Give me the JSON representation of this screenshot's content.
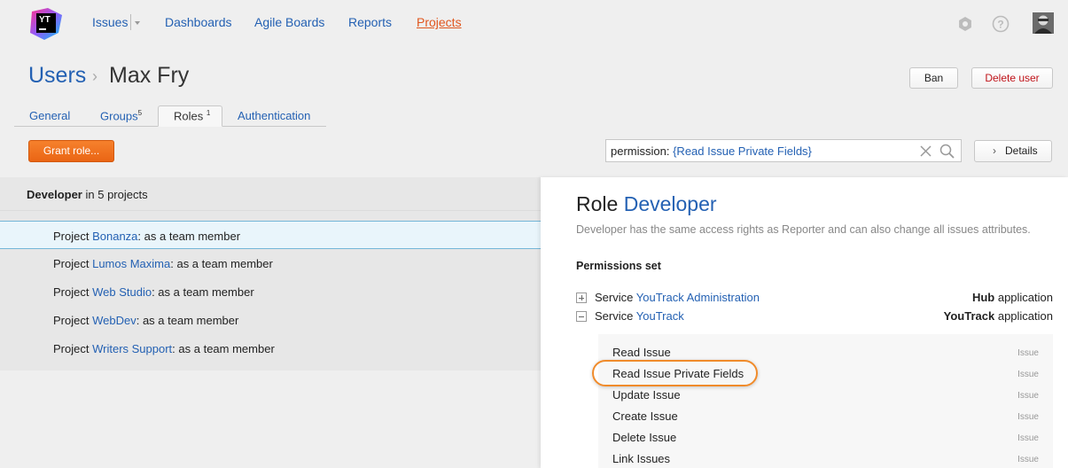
{
  "nav": {
    "logo_text": "YT",
    "items": [
      "Issues",
      "Dashboards",
      "Agile Boards",
      "Reports",
      "Projects"
    ],
    "active": "Projects"
  },
  "breadcrumb": {
    "parent": "Users",
    "separator": "›",
    "current": "Max Fry"
  },
  "actions": {
    "ban": "Ban",
    "delete": "Delete user"
  },
  "tabs": [
    {
      "label": "General",
      "count": ""
    },
    {
      "label": "Groups",
      "count": "5"
    },
    {
      "label": "Roles",
      "count": "1"
    },
    {
      "label": "Authentication",
      "count": ""
    }
  ],
  "grant_button": "Grant role...",
  "search": {
    "prefix": "permission:",
    "value": "{Read Issue Private Fields}"
  },
  "details_button": "Details",
  "left": {
    "header_role": "Developer",
    "header_suffix": "in 5 projects",
    "projects": [
      {
        "prefix": "Project",
        "name": "Bonanza",
        "suffix": ": as a team member"
      },
      {
        "prefix": "Project",
        "name": "Lumos Maxima",
        "suffix": ": as a team member"
      },
      {
        "prefix": "Project",
        "name": "Web Studio",
        "suffix": ": as a team member"
      },
      {
        "prefix": "Project",
        "name": "WebDev",
        "suffix": ": as a team member"
      },
      {
        "prefix": "Project",
        "name": "Writers Support",
        "suffix": ": as a team member"
      }
    ]
  },
  "role": {
    "title_prefix": "Role",
    "name": "Developer",
    "description": "Developer has the same access rights as Reporter and can also change all issues attributes.",
    "permissions_title": "Permissions set",
    "services": [
      {
        "prefix": "Service",
        "name": "YouTrack Administration",
        "app_bold": "Hub",
        "app_suffix": "application",
        "expanded": false
      },
      {
        "prefix": "Service",
        "name": "YouTrack",
        "app_bold": "YouTrack",
        "app_suffix": "application",
        "expanded": true
      }
    ],
    "permissions": [
      {
        "name": "Read Issue",
        "scope": "Issue"
      },
      {
        "name": "Read Issue Private Fields",
        "scope": "Issue"
      },
      {
        "name": "Update Issue",
        "scope": "Issue"
      },
      {
        "name": "Create Issue",
        "scope": "Issue"
      },
      {
        "name": "Delete Issue",
        "scope": "Issue"
      },
      {
        "name": "Link Issues",
        "scope": "Issue"
      }
    ]
  },
  "icons": [
    "youtrack-logo-icon",
    "settings-icon",
    "help-icon",
    "clear-icon",
    "search-icon",
    "chevron-right-icon"
  ],
  "colors": {
    "link": "#2461b3",
    "accent": "#ea6514",
    "danger": "#c0141a",
    "highlight": "#f08b2b"
  }
}
